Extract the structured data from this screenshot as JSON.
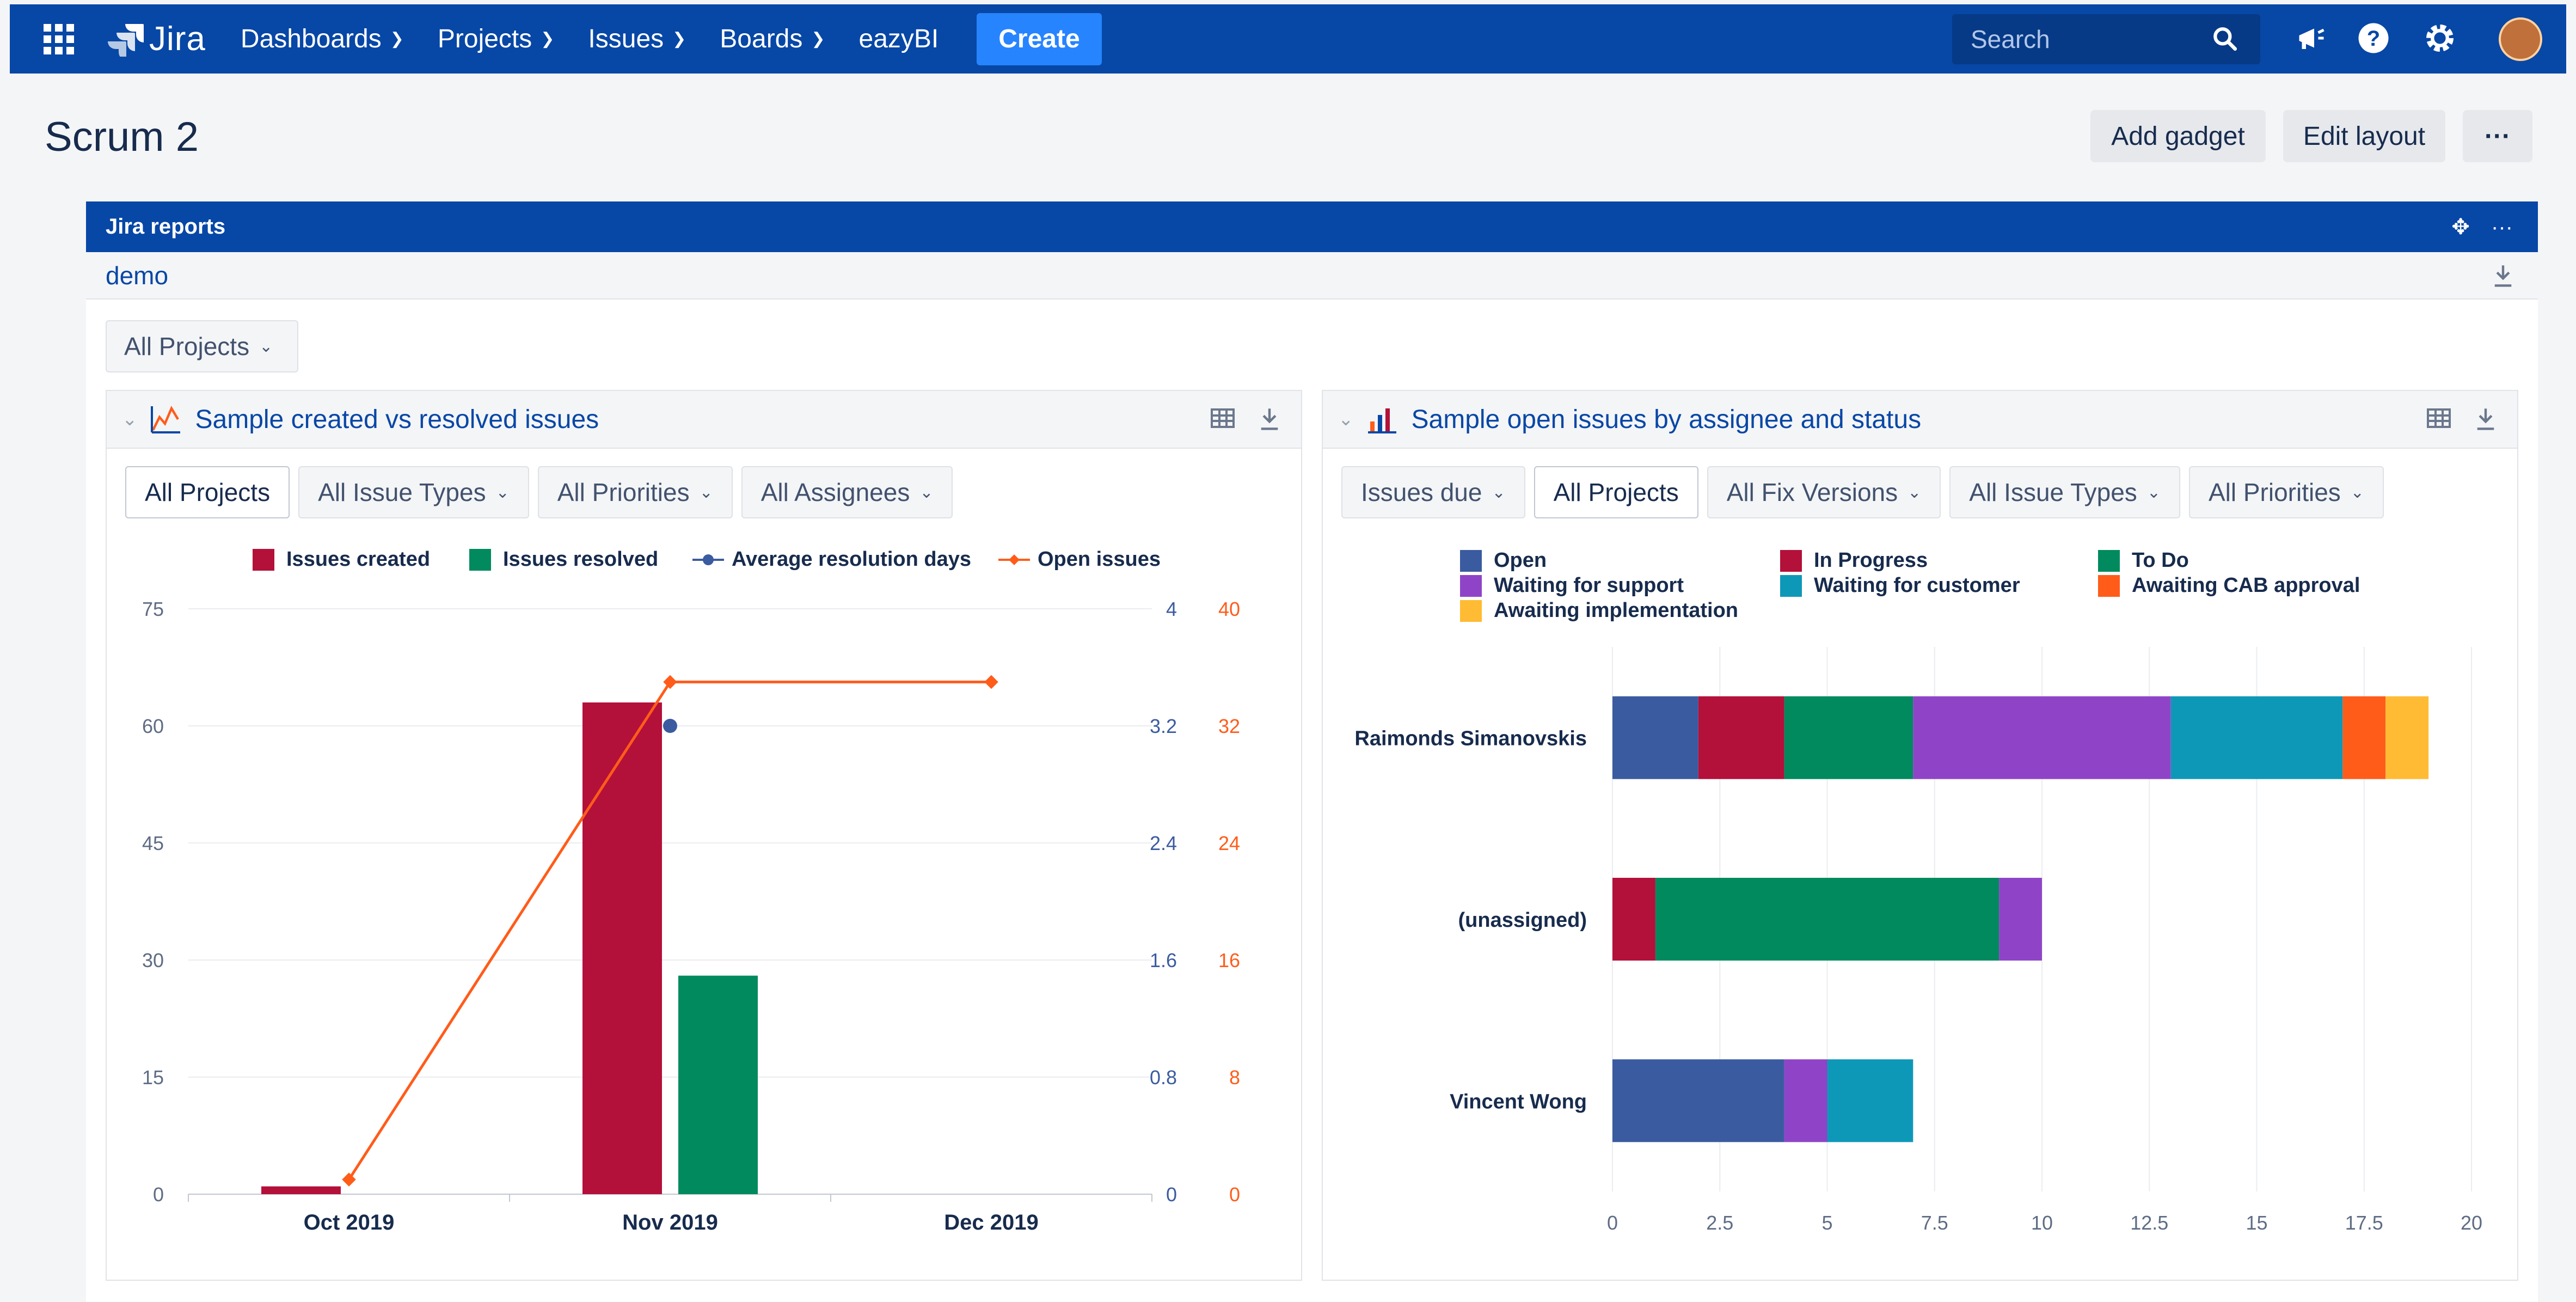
{
  "nav": {
    "logo_text": "Jira",
    "items": [
      {
        "label": "Dashboards"
      },
      {
        "label": "Projects"
      },
      {
        "label": "Issues"
      },
      {
        "label": "Boards"
      },
      {
        "label": "eazyBI"
      }
    ],
    "create_label": "Create",
    "search_placeholder": "Search",
    "icons": [
      "app-switcher-icon",
      "megaphone-icon",
      "help-icon",
      "settings-icon",
      "avatar"
    ],
    "accent": "#0747a6"
  },
  "page": {
    "title": "Scrum 2",
    "add_gadget_label": "Add gadget",
    "edit_layout_label": "Edit layout",
    "more_label": "···"
  },
  "gadget": {
    "title": "Jira reports",
    "subtitle": "demo",
    "all_projects_label": "All Projects"
  },
  "left_panel": {
    "title": "Sample created vs resolved issues",
    "filters": [
      {
        "label": "All Projects",
        "dropdown": false,
        "selected": true
      },
      {
        "label": "All Issue Types",
        "dropdown": true,
        "selected": false
      },
      {
        "label": "All Priorities",
        "dropdown": true,
        "selected": false
      },
      {
        "label": "All Assignees",
        "dropdown": true,
        "selected": false
      }
    ]
  },
  "right_panel": {
    "title": "Sample open issues by assignee and status",
    "filters": [
      {
        "label": "Issues due",
        "dropdown": true,
        "selected": false
      },
      {
        "label": "All Projects",
        "dropdown": false,
        "selected": true
      },
      {
        "label": "All Fix Versions",
        "dropdown": true,
        "selected": false
      },
      {
        "label": "All Issue Types",
        "dropdown": true,
        "selected": false
      },
      {
        "label": "All Priorities",
        "dropdown": true,
        "selected": false
      }
    ]
  },
  "chart_data": [
    {
      "type": "bar",
      "title": "Sample created vs resolved issues",
      "categories": [
        "Oct 2019",
        "Nov 2019",
        "Dec 2019"
      ],
      "series": [
        {
          "name": "Issues created",
          "type": "bar",
          "axis": "left",
          "color": "#b3103a",
          "values": [
            1,
            63,
            null
          ]
        },
        {
          "name": "Issues resolved",
          "type": "bar",
          "axis": "left",
          "color": "#008a5e",
          "values": [
            0,
            28,
            null
          ]
        },
        {
          "name": "Average resolution days",
          "type": "scatter",
          "axis": "right-days",
          "color": "#3b5ba0",
          "values": [
            null,
            3.2,
            null
          ]
        },
        {
          "name": "Open issues",
          "type": "line",
          "axis": "right-count",
          "color": "#ff5c1a",
          "values": [
            1,
            35,
            35
          ]
        }
      ],
      "ylim_left": [
        0,
        75
      ],
      "yticks_left": [
        "0",
        "15",
        "30",
        "45",
        "60",
        "75"
      ],
      "ylim_right_days": [
        0,
        4
      ],
      "yticks_right_days": [
        "0",
        "0.8",
        "1.6",
        "2.4",
        "3.2",
        "4"
      ],
      "ylim_right_count": [
        0,
        40
      ],
      "yticks_right_count": [
        "0",
        "8",
        "16",
        "24",
        "32",
        "40"
      ],
      "grid": true,
      "legend": "top"
    },
    {
      "type": "bar",
      "orientation": "horizontal",
      "stacked": true,
      "title": "Sample open issues by assignee and status",
      "categories": [
        "Raimonds Simanovskis",
        "(unassigned)",
        "Vincent Wong"
      ],
      "series": [
        {
          "name": "Open",
          "color": "#3b5ba0",
          "values": [
            2,
            0,
            4
          ]
        },
        {
          "name": "In Progress",
          "color": "#b3103a",
          "values": [
            2,
            1,
            0
          ]
        },
        {
          "name": "To Do",
          "color": "#008a5e",
          "values": [
            3,
            8,
            0
          ]
        },
        {
          "name": "Waiting for support",
          "color": "#8f44c8",
          "values": [
            6,
            1,
            1
          ]
        },
        {
          "name": "Waiting for customer",
          "color": "#0e98b8",
          "values": [
            4,
            0,
            2
          ]
        },
        {
          "name": "Awaiting CAB approval",
          "color": "#ff5c1a",
          "values": [
            1,
            0,
            0
          ]
        },
        {
          "name": "Awaiting implementation",
          "color": "#ffbb33",
          "values": [
            1,
            0,
            0
          ]
        }
      ],
      "xlim": [
        0,
        20
      ],
      "xticks": [
        "0",
        "2.5",
        "5",
        "7.5",
        "10",
        "12.5",
        "15",
        "17.5",
        "20"
      ],
      "grid": true,
      "legend": "top"
    }
  ]
}
